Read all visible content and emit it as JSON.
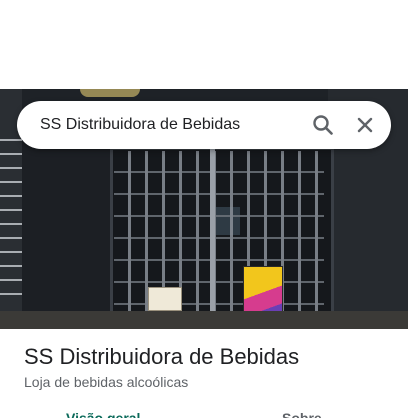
{
  "search": {
    "query": "SS Distribuidora de Bebidas"
  },
  "place": {
    "name": "SS Distribuidora de Bebidas",
    "category": "Loja de bebidas alcoólicas"
  },
  "tabs": [
    {
      "label": "Visão geral",
      "selected": true
    },
    {
      "label": "Sobre",
      "selected": false
    }
  ],
  "icons": {
    "search": "search-icon",
    "close": "close-icon"
  },
  "colors": {
    "selected_tab": "#0b6a5a",
    "title_text": "#202124",
    "secondary_text": "#5f6368"
  }
}
